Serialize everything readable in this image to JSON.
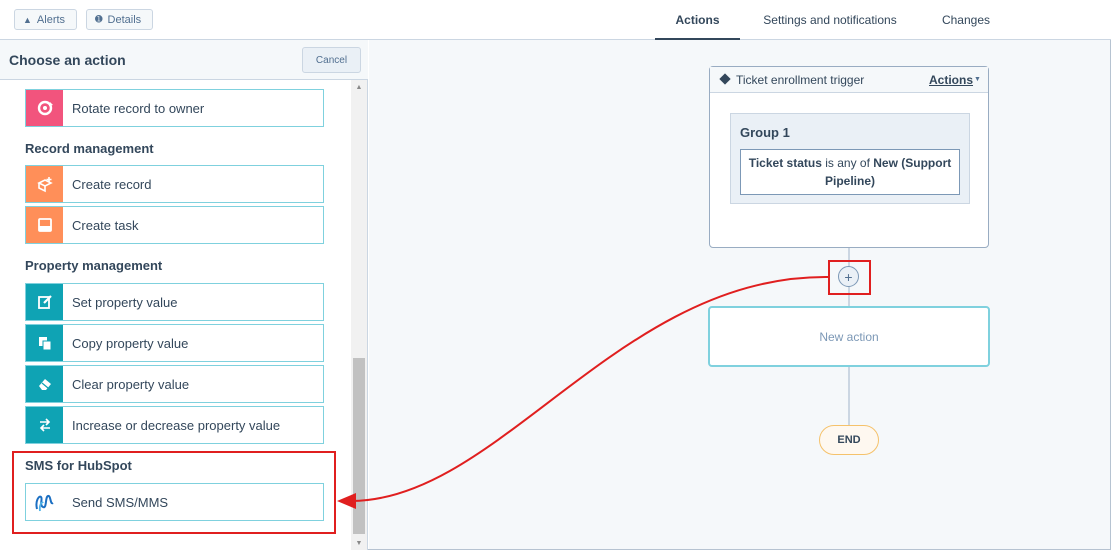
{
  "topbar": {
    "alerts_label": "Alerts",
    "details_label": "Details",
    "tabs": [
      {
        "label": "Actions",
        "active": true
      },
      {
        "label": "Settings and notifications",
        "active": false
      },
      {
        "label": "Changes",
        "active": false
      }
    ]
  },
  "panel": {
    "title": "Choose an action",
    "cancel_label": "Cancel",
    "partial_item": {
      "label": "Rotate record to owner",
      "icon": "rotate-owner-icon"
    },
    "sections": [
      {
        "title": "Record management",
        "items": [
          {
            "label": "Create record",
            "icon": "create-record-icon"
          },
          {
            "label": "Create task",
            "icon": "create-task-icon"
          }
        ]
      },
      {
        "title": "Property management",
        "items": [
          {
            "label": "Set property value",
            "icon": "edit-icon"
          },
          {
            "label": "Copy property value",
            "icon": "copy-icon"
          },
          {
            "label": "Clear property value",
            "icon": "eraser-icon"
          },
          {
            "label": "Increase or decrease property value",
            "icon": "swap-arrows-icon"
          }
        ]
      },
      {
        "title": "SMS for HubSpot",
        "items": [
          {
            "label": "Send SMS/MMS",
            "icon": "sms-logo-icon"
          }
        ]
      }
    ]
  },
  "canvas": {
    "trigger": {
      "title": "Ticket enrollment trigger",
      "actions_label": "Actions",
      "group_title": "Group 1",
      "condition_property": "Ticket status",
      "condition_operator": " is any of ",
      "condition_value": "New (Support Pipeline)"
    },
    "add_button": "+",
    "new_action_label": "New action",
    "end_label": "END"
  },
  "colors": {
    "accent_teal": "#0fa3b4",
    "pink": "#f2547d",
    "orange": "#ff8f59",
    "highlight_red": "#e01f1f",
    "text_dark": "#33475b"
  }
}
